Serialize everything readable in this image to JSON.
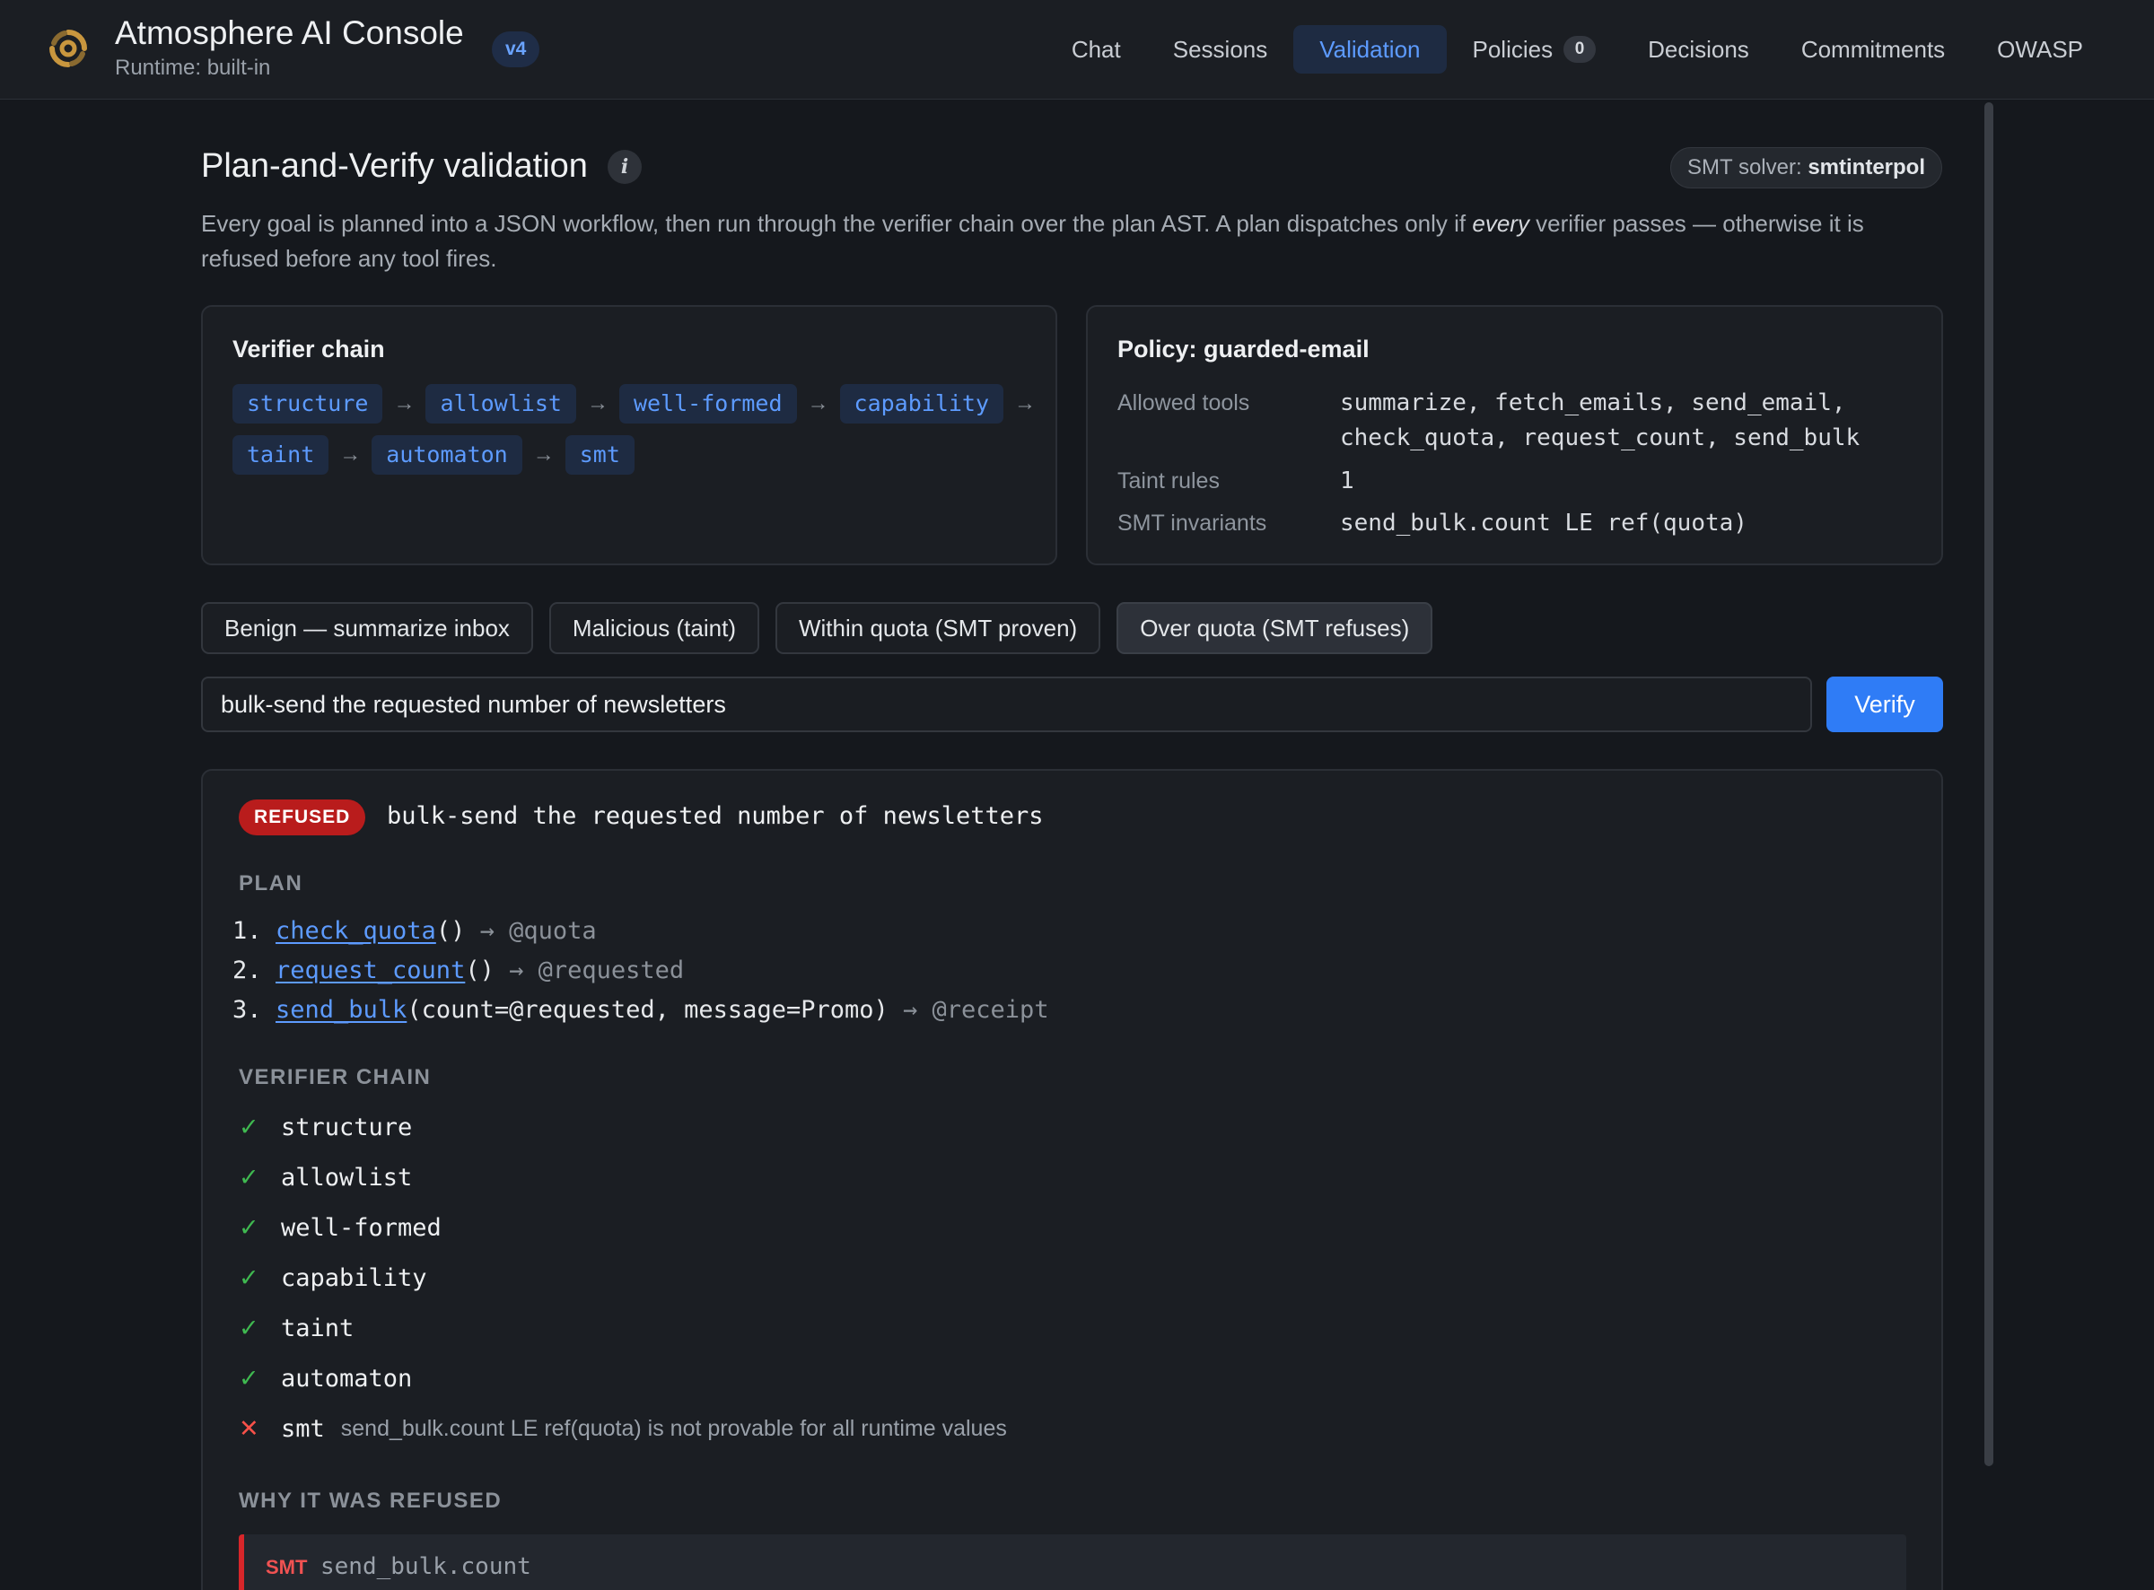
{
  "header": {
    "title": "Atmosphere AI Console",
    "subtitle": "Runtime: built-in",
    "version": "v4",
    "nav": [
      {
        "label": "Chat"
      },
      {
        "label": "Sessions"
      },
      {
        "label": "Validation",
        "active": true
      },
      {
        "label": "Policies",
        "count": "0"
      },
      {
        "label": "Decisions"
      },
      {
        "label": "Commitments"
      },
      {
        "label": "OWASP"
      }
    ]
  },
  "page": {
    "title": "Plan-and-Verify validation",
    "solver_label": "SMT solver:",
    "solver_value": "smtinterpol",
    "description_a": "Every goal is planned into a JSON workflow, then run through the verifier chain over the plan AST. A plan dispatches only if ",
    "description_em": "every",
    "description_b": " verifier passes — otherwise it is refused before any tool fires."
  },
  "verifier_chain": {
    "title": "Verifier chain",
    "row1": [
      "structure",
      "allowlist",
      "well-formed",
      "capability"
    ],
    "row2": [
      "taint",
      "automaton",
      "smt"
    ],
    "arrow": "→"
  },
  "policy": {
    "title": "Policy: guarded-email",
    "allowed_tools_label": "Allowed tools",
    "allowed_tools_line1": "summarize, fetch_emails, send_email,",
    "allowed_tools_line2": "check_quota, request_count, send_bulk",
    "taint_rules_label": "Taint rules",
    "taint_rules_value": "1",
    "smt_invariants_label": "SMT invariants",
    "smt_invariants_value": "send_bulk.count LE ref(quota)"
  },
  "presets": [
    {
      "label": "Benign — summarize inbox"
    },
    {
      "label": "Malicious (taint)"
    },
    {
      "label": "Within quota (SMT proven)"
    },
    {
      "label": "Over quota (SMT refuses)",
      "active": true
    }
  ],
  "input": {
    "value": "bulk-send the requested number of newsletters",
    "button": "Verify"
  },
  "result": {
    "status": "REFUSED",
    "goal": "bulk-send the requested number of newsletters",
    "plan_label": "PLAN",
    "plan": [
      {
        "num": "1.",
        "fn": "check_quota",
        "args": "()",
        "ret": "→ @quota"
      },
      {
        "num": "2.",
        "fn": "request_count",
        "args": "()",
        "ret": "→ @requested"
      },
      {
        "num": "3.",
        "fn": "send_bulk",
        "args": "(count=@requested, message=Promo)",
        "ret": "→ @receipt"
      }
    ],
    "chain_label": "VERIFIER CHAIN",
    "checks": [
      {
        "mark": "✓",
        "name": "structure",
        "detail": ""
      },
      {
        "mark": "✓",
        "name": "allowlist",
        "detail": ""
      },
      {
        "mark": "✓",
        "name": "well-formed",
        "detail": ""
      },
      {
        "mark": "✓",
        "name": "capability",
        "detail": ""
      },
      {
        "mark": "✓",
        "name": "taint",
        "detail": ""
      },
      {
        "mark": "✓",
        "name": "automaton",
        "detail": ""
      },
      {
        "mark": "✕",
        "name": "smt",
        "detail": "send_bulk.count LE ref(quota) is not provable for all runtime values"
      }
    ],
    "why_label": "WHY IT WAS REFUSED",
    "why_tag": "SMT",
    "why_text": "send_bulk.count"
  },
  "colors": {
    "accent": "#2f7cf6",
    "chip_text": "#5d9bff",
    "pass": "#3fb950",
    "fail": "#f85149",
    "refused": "#b91c1c",
    "logo": "#c8963e"
  }
}
